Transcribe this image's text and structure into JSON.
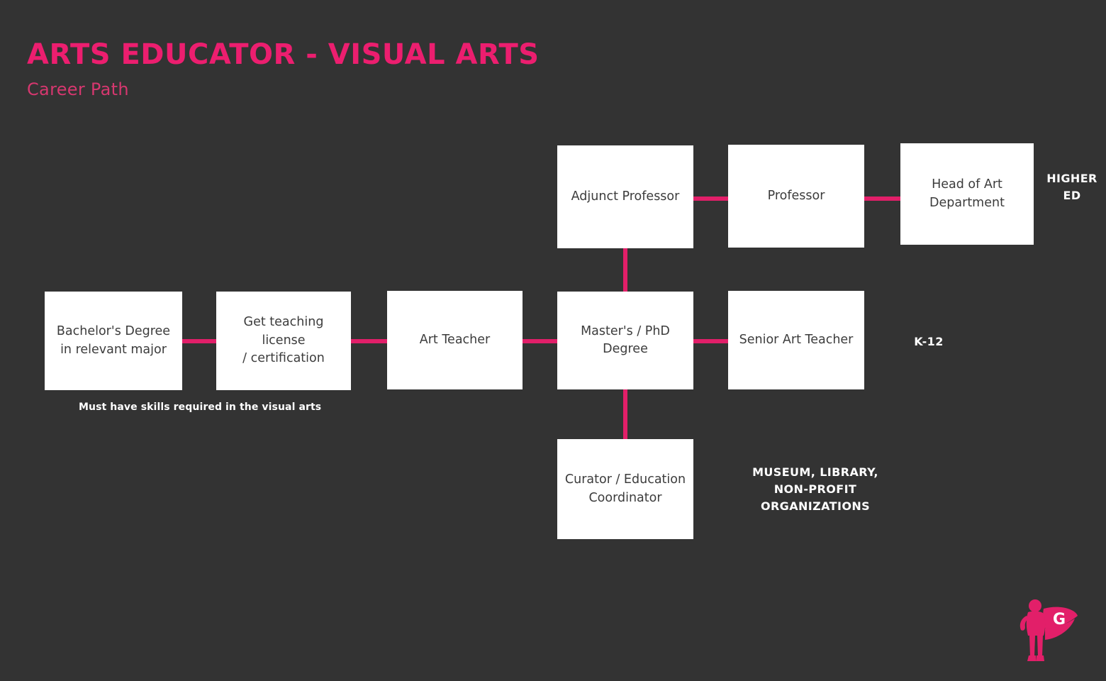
{
  "header": {
    "title": "ARTS EDUCATOR - VISUAL ARTS",
    "subtitle": "Career Path"
  },
  "colors": {
    "background": "#333333",
    "accent_pink": "#E21F69",
    "title_pink": "#EC1E6F",
    "node_fill": "#FFFFFF",
    "node_text": "#3C3C3C",
    "label_text": "#FFFFFF"
  },
  "nodes": [
    {
      "id": "bachelors",
      "line1": "Bachelor's Degree",
      "line2": "in relevant major"
    },
    {
      "id": "teaching-license",
      "line1": "Get teaching license",
      "line2": "/ certification"
    },
    {
      "id": "art-teacher",
      "line1": "Art Teacher",
      "line2": ""
    },
    {
      "id": "masters-phd",
      "line1": "Master's / PhD",
      "line2": "Degree"
    },
    {
      "id": "senior-art-teacher",
      "line1": "Senior Art Teacher",
      "line2": ""
    },
    {
      "id": "adjunct-professor",
      "line1": "Adjunct Professor",
      "line2": ""
    },
    {
      "id": "professor",
      "line1": "Professor",
      "line2": ""
    },
    {
      "id": "head-of-art-dept",
      "line1": "Head of Art",
      "line2": "Department"
    },
    {
      "id": "curator",
      "line1": "Curator / Education",
      "line2": "Coordinator"
    }
  ],
  "track_labels": {
    "higher_ed_line1": "HIGHER",
    "higher_ed_line2": "ED",
    "k12": "K-12",
    "museum_line1": "MUSEUM, LIBRARY,",
    "museum_line2": "NON-PROFIT",
    "museum_line3": "ORGANIZATIONS"
  },
  "captions": {
    "skills_note": "Must have skills required in the visual arts"
  },
  "logo": {
    "letter": "G"
  },
  "chart_data": {
    "type": "diagram",
    "title": "ARTS EDUCATOR - VISUAL ARTS Career Path",
    "edges": [
      {
        "from": "bachelors",
        "to": "teaching-license",
        "orientation": "horizontal"
      },
      {
        "from": "teaching-license",
        "to": "art-teacher",
        "orientation": "horizontal"
      },
      {
        "from": "art-teacher",
        "to": "masters-phd",
        "orientation": "horizontal"
      },
      {
        "from": "masters-phd",
        "to": "senior-art-teacher",
        "orientation": "horizontal"
      },
      {
        "from": "masters-phd",
        "to": "adjunct-professor",
        "orientation": "vertical"
      },
      {
        "from": "adjunct-professor",
        "to": "professor",
        "orientation": "horizontal"
      },
      {
        "from": "professor",
        "to": "head-of-art-dept",
        "orientation": "horizontal"
      },
      {
        "from": "masters-phd",
        "to": "curator",
        "orientation": "vertical"
      }
    ],
    "tracks": [
      {
        "label": "HIGHER ED",
        "nodes": [
          "adjunct-professor",
          "professor",
          "head-of-art-dept"
        ]
      },
      {
        "label": "K-12",
        "nodes": [
          "senior-art-teacher"
        ]
      },
      {
        "label": "MUSEUM, LIBRARY, NON-PROFIT ORGANIZATIONS",
        "nodes": [
          "curator"
        ]
      }
    ]
  }
}
